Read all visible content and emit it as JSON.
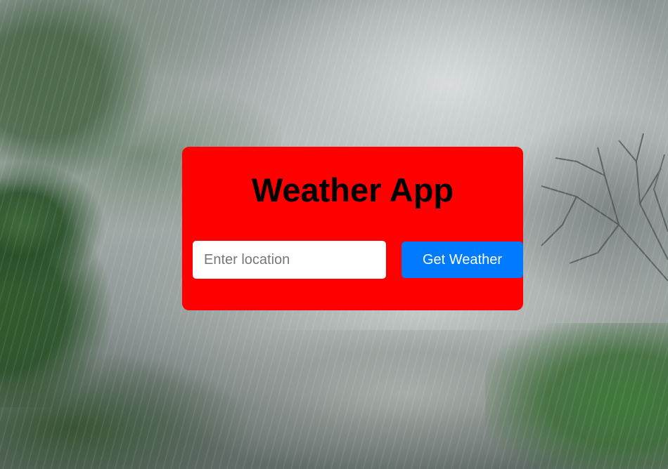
{
  "app": {
    "title": "Weather App"
  },
  "search": {
    "placeholder": "Enter location",
    "value": ""
  },
  "actions": {
    "get_weather_label": "Get Weather"
  },
  "colors": {
    "card_background": "#ff0000",
    "button_background": "#007bff",
    "button_text": "#ffffff",
    "title_text": "#000000"
  }
}
